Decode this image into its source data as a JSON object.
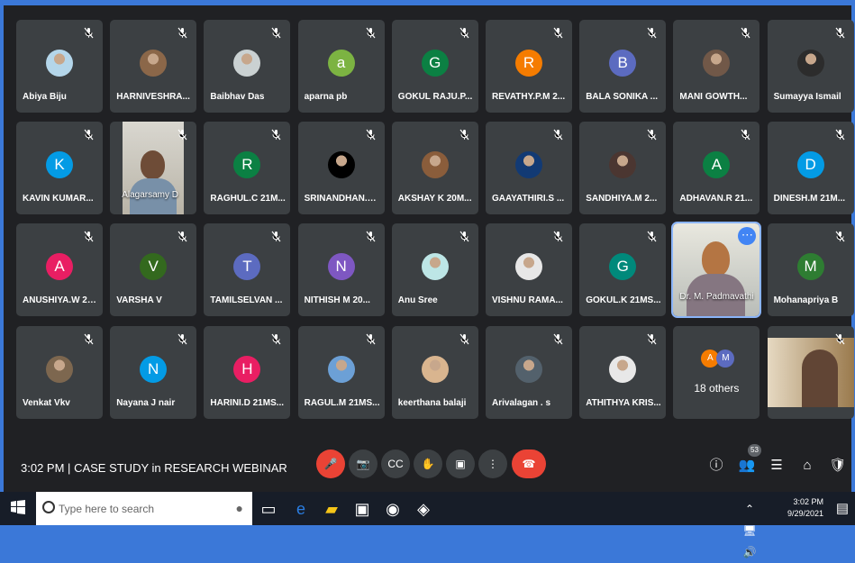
{
  "meeting": {
    "time": "3:02 PM",
    "separator": "|",
    "title": "CASE STUDY in RESEARCH WEBINAR"
  },
  "participants": [
    {
      "name": "Abiya Biju",
      "avatar": "photo",
      "color": "#b4d6ea"
    },
    {
      "name": "HARNIVESHRA...",
      "avatar": "photo",
      "color": "#8b6749"
    },
    {
      "name": "Baibhav Das",
      "avatar": "photo",
      "color": "#cad1d2"
    },
    {
      "name": "aparna pb",
      "initial": "a",
      "color": "#7cb342"
    },
    {
      "name": "GOKUL RAJU.P...",
      "initial": "G",
      "color": "#0b8043"
    },
    {
      "name": "REVATHY.P.M 2...",
      "initial": "R",
      "color": "#f57c00"
    },
    {
      "name": "BALA SONIKA ...",
      "initial": "B",
      "color": "#5c6bc0"
    },
    {
      "name": "MANI GOWTH...",
      "avatar": "photo",
      "color": "#715848"
    },
    {
      "name": "Sumayya Ismail",
      "avatar": "photo",
      "color": "#2c2c2c"
    },
    {
      "name": "KAVIN KUMAR...",
      "initial": "K",
      "color": "#039be5"
    },
    {
      "name": "Alagarsamy D",
      "avatar": "video",
      "color": "#b9b4a7"
    },
    {
      "name": "RAGHUL.C 21M...",
      "initial": "R",
      "color": "#0b8043"
    },
    {
      "name": "SRINANDHAN.V...",
      "avatar": "photo",
      "color": "#000000"
    },
    {
      "name": "AKSHAY K 20M...",
      "avatar": "photo",
      "color": "#8a5d3b"
    },
    {
      "name": "GAAYATHIRI.S ...",
      "avatar": "photo",
      "color": "#123a74"
    },
    {
      "name": "SANDHIYA.M 2...",
      "avatar": "photo",
      "color": "#4b3631"
    },
    {
      "name": "ADHAVAN.R 21...",
      "initial": "A",
      "color": "#0b8043"
    },
    {
      "name": "DINESH.M 21M...",
      "initial": "D",
      "color": "#039be5"
    },
    {
      "name": "ANUSHIYA.W 21...",
      "initial": "A",
      "color": "#e91e63"
    },
    {
      "name": "VARSHA V",
      "initial": "V",
      "color": "#33691e"
    },
    {
      "name": "TAMILSELVAN ...",
      "initial": "T",
      "color": "#5c6bc0"
    },
    {
      "name": "NITHISH M 20...",
      "initial": "N",
      "color": "#7e57c2"
    },
    {
      "name": "Anu Sree",
      "avatar": "photo",
      "color": "#bde6e6"
    },
    {
      "name": "VISHNU RAMA...",
      "avatar": "photo",
      "color": "#e7e7e7"
    },
    {
      "name": "GOKUL.K 21MS...",
      "initial": "G",
      "color": "#00897b"
    },
    {
      "name": "Dr. M. Padmavathi",
      "avatar": "highlight",
      "color": "#b47543"
    },
    {
      "name": "Mohanapriya B",
      "initial": "M",
      "color": "#2e7d32"
    },
    {
      "name": "Venkat Vkv",
      "avatar": "photo",
      "color": "#7d674f"
    },
    {
      "name": "Nayana J nair",
      "initial": "N",
      "color": "#039be5"
    },
    {
      "name": "HARINI.D 21MS...",
      "initial": "H",
      "color": "#e91e63"
    },
    {
      "name": "RAGUL.M 21MS...",
      "avatar": "photo",
      "color": "#6ca0d6"
    },
    {
      "name": "keerthana balaji",
      "avatar": "photo",
      "color": "#d9b58f"
    },
    {
      "name": "Arivalagan . s",
      "avatar": "photo",
      "color": "#53616c"
    },
    {
      "name": "ATHITHYA KRIS...",
      "avatar": "photo",
      "color": "#e8e8e8"
    },
    {
      "name": "18 others",
      "avatar": "others",
      "color": "#3c4043",
      "others": [
        "A",
        "M"
      ]
    },
    {
      "name": "",
      "avatar": "camera",
      "color": "#6d5440"
    }
  ],
  "controls": {
    "mute": "🎤",
    "camera": "📷",
    "captions": "CC",
    "raise_hand": "✋",
    "present": "▣",
    "more": "⋮",
    "end": "☎"
  },
  "side_controls": {
    "info": "ⓘ",
    "people": "👥",
    "people_count": "53",
    "chat": "☰",
    "activities": "⌂",
    "host": "🛡"
  },
  "taskbar": {
    "search_placeholder": "Type here to search",
    "time": "3:02 PM",
    "date": "9/29/2021"
  }
}
